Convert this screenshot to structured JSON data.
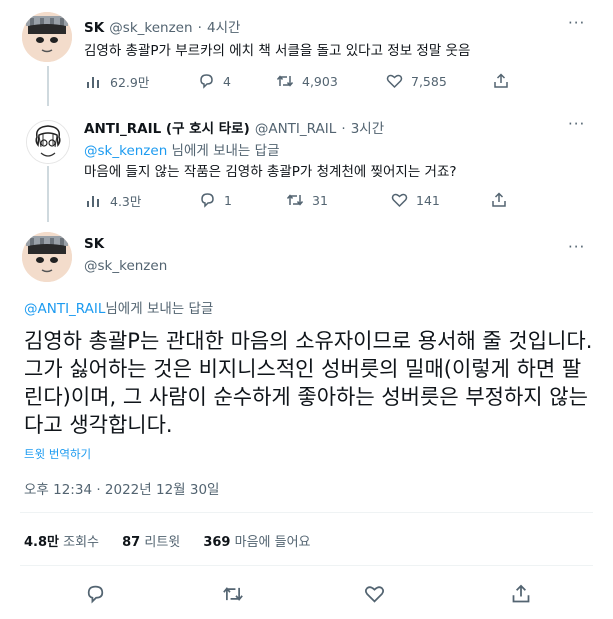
{
  "tweet1": {
    "name": "SK",
    "handle": "@sk_kenzen",
    "time": "4시간",
    "separator": "·",
    "text": "김영하 총괄P가 부르카의 에치 책 서클을 돌고 있다고 정보 정말 웃음",
    "views": "62.9만",
    "replies": "4",
    "retweets": "4,903",
    "likes": "7,585"
  },
  "tweet2": {
    "name": "ANTI_RAIL (구 호시 타로)",
    "handle": "@ANTI_RAIL",
    "time": "3시간",
    "separator": "·",
    "reply_mention": "@sk_kenzen",
    "reply_suffix": " 님에게 보내는 답글",
    "text": "마음에 들지 않는 작품은 김영하 총괄P가 청계천에 찢어지는 거죠?",
    "views": "4.3만",
    "replies": "1",
    "retweets": "31",
    "likes": "141"
  },
  "main": {
    "name": "SK",
    "handle": "@sk_kenzen",
    "reply_mention": "@ANTI_RAIL",
    "reply_suffix": "님에게 보내는 답글",
    "text": "김영하 총괄P는 관대한 마음의 소유자이므로 용서해 줄 것입니다. 그가 싫어하는 것은 비지니스적인 성버릇의 밀매(이렇게 하면 팔린다)이며, 그 사람이 순수하게 좋아하는 성버릇은 부정하지 않는다고 생각합니다.",
    "translate": "트윗 번역하기",
    "datetime": "오후 12:34 · 2022년 12월 30일",
    "views_num": "4.8만",
    "views_label": "조회수",
    "retweets_num": "87",
    "retweets_label": "리트윗",
    "likes_num": "369",
    "likes_label": "마음에 들어요"
  },
  "icons": [
    "more-icon",
    "views-icon",
    "reply-icon",
    "retweet-icon",
    "like-icon",
    "share-icon"
  ],
  "colors": {
    "accent": "#1d9bf0",
    "text": "#0f1419",
    "muted": "#536471",
    "border": "#eff3f4"
  }
}
